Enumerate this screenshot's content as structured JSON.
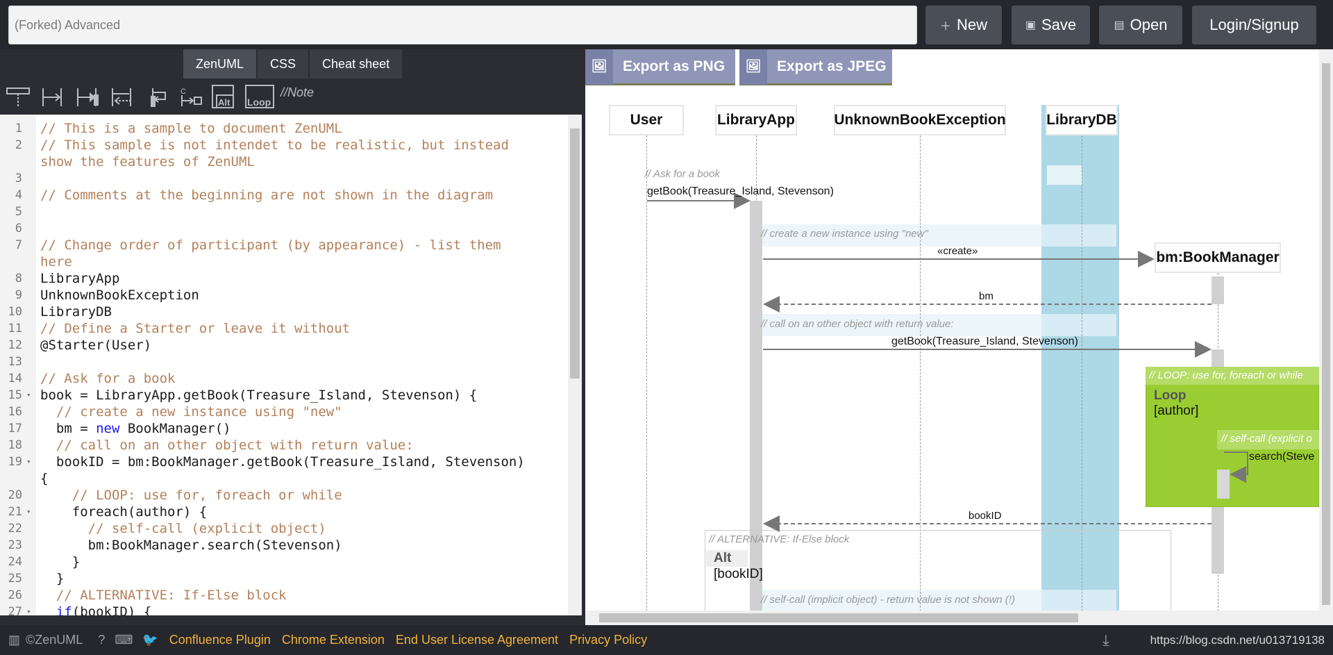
{
  "header": {
    "title_value": "(Forked) Advanced",
    "buttons": {
      "new": "New",
      "save": "Save",
      "open": "Open",
      "login": "Login/Signup"
    }
  },
  "editor_tabs": [
    "ZenUML",
    "CSS",
    "Cheat sheet"
  ],
  "toolbar": {
    "alt_label": "Alt",
    "loop_label": "Loop",
    "note_label": "//Note",
    "c_label": "C"
  },
  "code": {
    "line_numbers": [
      "1",
      "2",
      "",
      "3",
      "4",
      "5",
      "6",
      "7",
      "",
      "8",
      "9",
      "10",
      "11",
      "12",
      "13",
      "14",
      "15",
      "16",
      "17",
      "18",
      "19",
      "",
      "20",
      "21",
      "22",
      "23",
      "24",
      "25",
      "26",
      "27"
    ],
    "lines": [
      "// This is a sample to document ZenUML",
      "// This sample is not intendet to be realistic, but instead",
      "show the features of ZenUML",
      "",
      "// Comments at the beginning are not shown in the diagram",
      "",
      "",
      "// Change order of participant (by appearance) - list them",
      "here",
      "LibraryApp",
      "UnknownBookException",
      "LibraryDB",
      "// Define a Starter or leave it without",
      "@Starter(User)",
      "",
      "// Ask for a book",
      "book = LibraryApp.getBook(Treasure_Island, Stevenson) {",
      "  // create a new instance using \"new\"",
      "  bm = new BookManager()",
      "  // call on an other object with return value:",
      "  bookID = bm:BookManager.getBook(Treasure_Island, Stevenson)",
      "{",
      "    // LOOP: use for, foreach or while",
      "    foreach(author) {",
      "      // self-call (explicit object)",
      "      bm:BookManager.search(Stevenson)",
      "    }",
      "  }",
      "  // ALTERNATIVE: If-Else block",
      "  if(bookID) {"
    ]
  },
  "export": {
    "png": "Export as PNG",
    "jpeg": "Export as JPEG"
  },
  "diagram": {
    "participants": [
      "User",
      "LibraryApp",
      "UnknownBookException",
      "LibraryDB",
      "bm:BookManager"
    ],
    "comment_ask": "// Ask for a book",
    "msg_getbook": "getBook(Treasure_Island, Stevenson)",
    "comment_create": "// create a new instance using \"new\"",
    "msg_create": "«create»",
    "msg_bm": "bm",
    "comment_call": "// call on an other object with return value:",
    "msg_getbook2": "getBook(Treasure_Island, Stevenson)",
    "loop_comment": "// LOOP: use for, foreach or while",
    "loop_title": "Loop",
    "loop_cond": "[author]",
    "self_comment": "// self-call (explicit o",
    "self_msg": "search(Steve",
    "msg_bookid": "bookID",
    "alt_comment": "// ALTERNATIVE: If-Else block",
    "alt_title": "Alt",
    "alt_cond": "[bookID]",
    "self_implicit_comment": "// self-call (implicit object) - return value is not shown (!)"
  },
  "footer": {
    "brand": "©ZenUML",
    "links": [
      "Confluence Plugin",
      "Chrome Extension",
      "End User License Agreement",
      "Privacy Policy"
    ],
    "url": "https://blog.csdn.net/u013719138"
  },
  "colors": {
    "loop_fill": "#9acd32",
    "db_highlight": "#add8e6",
    "accent_link": "#f2b33d",
    "export_btn": "#8f96b8"
  }
}
